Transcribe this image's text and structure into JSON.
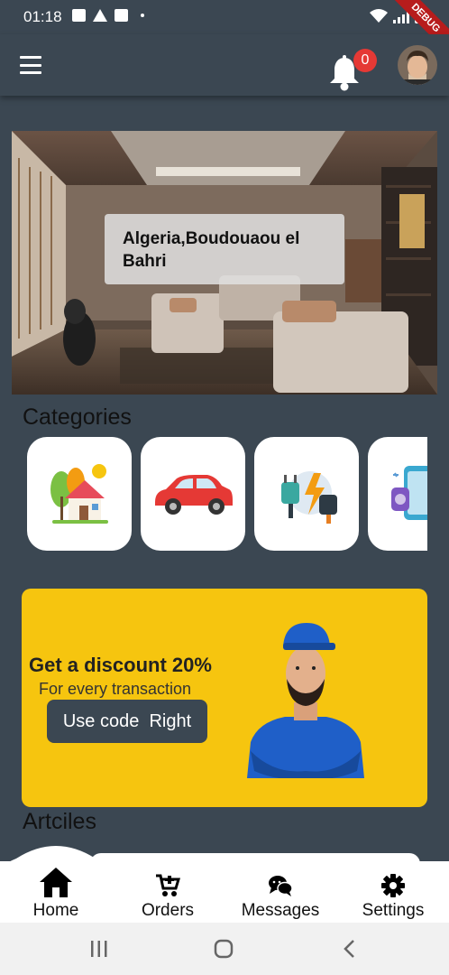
{
  "status_bar": {
    "time": "01:18",
    "debug_label": "DEBUG"
  },
  "app_bar": {
    "notification_count": "0",
    "menu_icon": "hamburger-menu-icon",
    "bell_icon": "bell-icon"
  },
  "hero": {
    "location": "Algeria,Boudouaou el Bahri"
  },
  "categories": {
    "title": "Categories",
    "items": [
      {
        "icon": "house-icon"
      },
      {
        "icon": "car-icon"
      },
      {
        "icon": "electric-plug-icon"
      },
      {
        "icon": "electronics-devices-icon"
      }
    ]
  },
  "promo": {
    "title": "Get a discount 20%",
    "subtitle": "For every transaction",
    "button_label": "Use code  Right",
    "background_color": "#f6c50f"
  },
  "articles": {
    "title": "Artciles"
  },
  "bottom_nav": {
    "items": [
      {
        "label": "Home",
        "icon": "home-icon"
      },
      {
        "label": "Orders",
        "icon": "cart-icon"
      },
      {
        "label": "Messages",
        "icon": "chat-icon"
      },
      {
        "label": "Settings",
        "icon": "gear-icon"
      }
    ]
  },
  "colors": {
    "background": "#3b4752",
    "accent": "#f6c50f",
    "badge": "#e53935"
  }
}
